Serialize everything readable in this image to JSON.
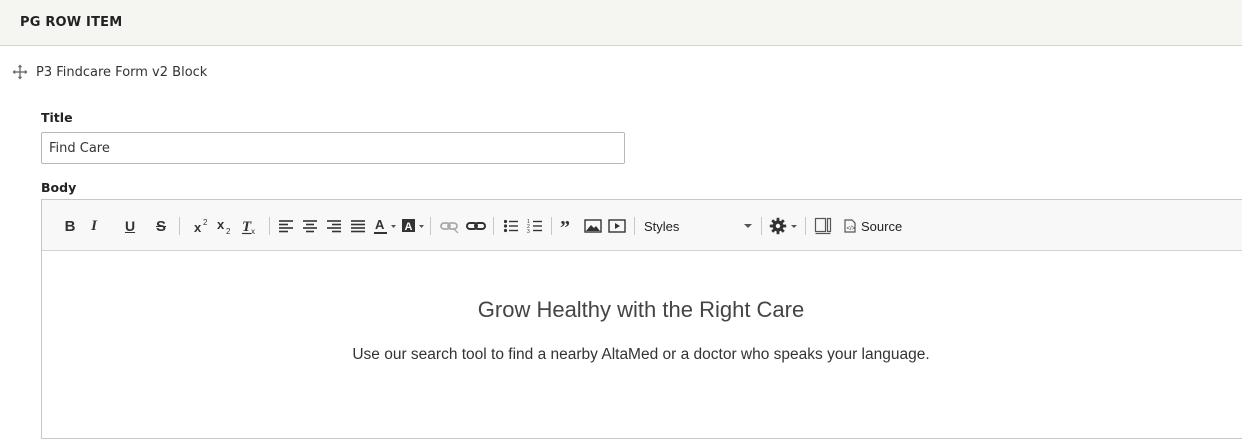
{
  "section": {
    "title": "PG ROW ITEM"
  },
  "row_item": {
    "label": "P3 Findcare Form v2 Block",
    "icon": "drag-move-icon"
  },
  "fields": {
    "title_label": "Title",
    "title_value": "Find Care",
    "body_label": "Body"
  },
  "toolbar": {
    "bold": "B",
    "italic": "I",
    "underline": "U",
    "strike": "S",
    "styles_label": "Styles",
    "source_label": "Source"
  },
  "content": {
    "heading": "Grow Healthy with the Right Care",
    "subtext": "Use our search tool to find a nearby AltaMed or a doctor who speaks your language."
  }
}
